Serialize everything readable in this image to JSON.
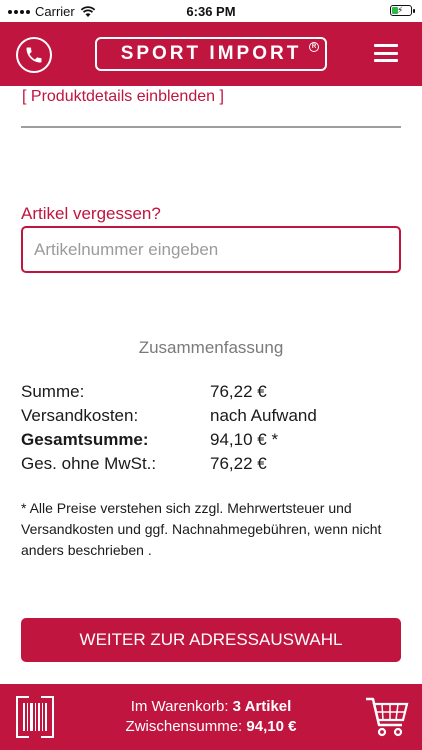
{
  "status_bar": {
    "carrier": "Carrier",
    "time": "6:36 PM",
    "battery_level": 0.3
  },
  "header": {
    "logo_text": "SPORT IMPORT",
    "logo_registered": "R",
    "phone_icon": "phone-icon",
    "menu_icon": "hamburger-menu-icon"
  },
  "details": {
    "toggle_label": "[ Produktdetails einblenden ]"
  },
  "forgot": {
    "label": "Artikel vergessen?",
    "placeholder": "Artikelnummer eingeben",
    "value": ""
  },
  "summary": {
    "title": "Zusammenfassung",
    "rows": [
      {
        "label": "Summe:",
        "value": "76,22 €"
      },
      {
        "label": "Versandkosten:",
        "value": "nach Aufwand"
      },
      {
        "label": "Gesamtsumme:",
        "value": "94,10 € *"
      },
      {
        "label": "Ges. ohne MwSt.:",
        "value": "76,22 €"
      }
    ],
    "note": "* Alle Preise verstehen sich zzgl. Mehrwertsteuer und Versandkosten und ggf. Nachnahmegebühren, wenn nicht anders beschrieben ."
  },
  "actions": {
    "continue_label": "WEITER ZUR ADRESSAUSWAHL"
  },
  "footer": {
    "cart_label": "Im Warenkorb:",
    "cart_count": "3 Artikel",
    "subtotal_label": "Zwischensumme:",
    "subtotal_value": "94,10 €",
    "barcode_icon": "barcode-scanner-icon",
    "cart_icon": "shopping-cart-icon"
  },
  "colors": {
    "brand": "#c0153f",
    "muted": "#7a7a7a"
  }
}
